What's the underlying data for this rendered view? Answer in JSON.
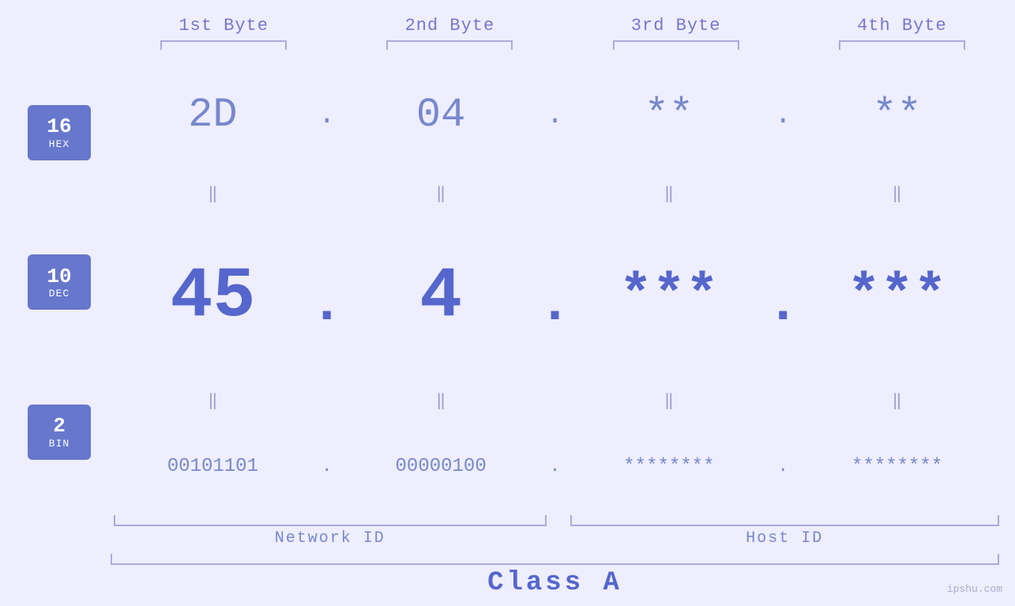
{
  "headers": {
    "byte1": "1st Byte",
    "byte2": "2nd Byte",
    "byte3": "3rd Byte",
    "byte4": "4th Byte"
  },
  "badges": {
    "hex": {
      "number": "16",
      "label": "HEX"
    },
    "dec": {
      "number": "10",
      "label": "DEC"
    },
    "bin": {
      "number": "2",
      "label": "BIN"
    }
  },
  "hex_row": {
    "b1": "2D",
    "b2": "04",
    "b3": "**",
    "b4": "**",
    "sep": "."
  },
  "dec_row": {
    "b1": "45",
    "b2": "4",
    "b3": "***",
    "b4": "***",
    "sep": "."
  },
  "bin_row": {
    "b1": "00101101",
    "b2": "00000100",
    "b3": "********",
    "b4": "********",
    "sep": "."
  },
  "network_id_label": "Network ID",
  "host_id_label": "Host ID",
  "class_label": "Class A",
  "watermark": "ipshu.com"
}
